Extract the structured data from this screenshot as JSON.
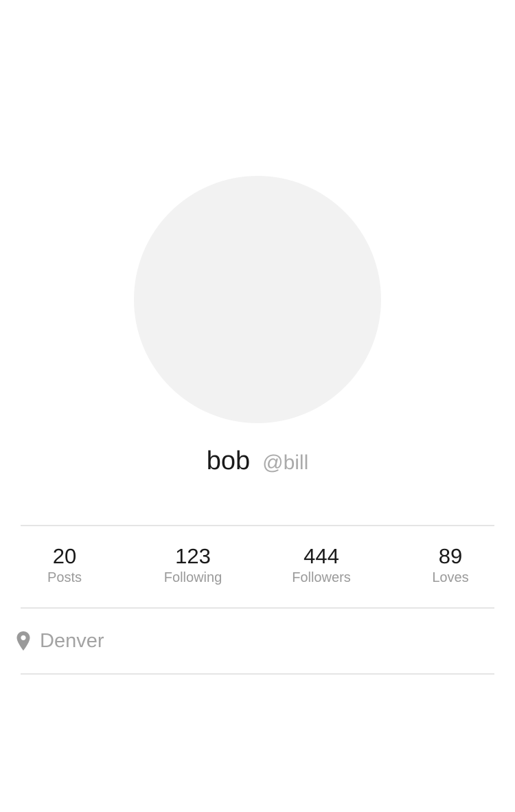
{
  "profile": {
    "display_name": "bob",
    "username": "@bill"
  },
  "stats": [
    {
      "value": "20",
      "label": "Posts"
    },
    {
      "value": "123",
      "label": "Following"
    },
    {
      "value": "444",
      "label": "Followers"
    },
    {
      "value": "89",
      "label": "Loves"
    }
  ],
  "location": {
    "icon": "map-pin-icon",
    "text": "Denver"
  },
  "colors": {
    "avatar_placeholder": "#f2f2f2",
    "primary_text": "#1a1a1a",
    "secondary_text": "#9a9a9a",
    "divider": "#e5e5e5"
  }
}
